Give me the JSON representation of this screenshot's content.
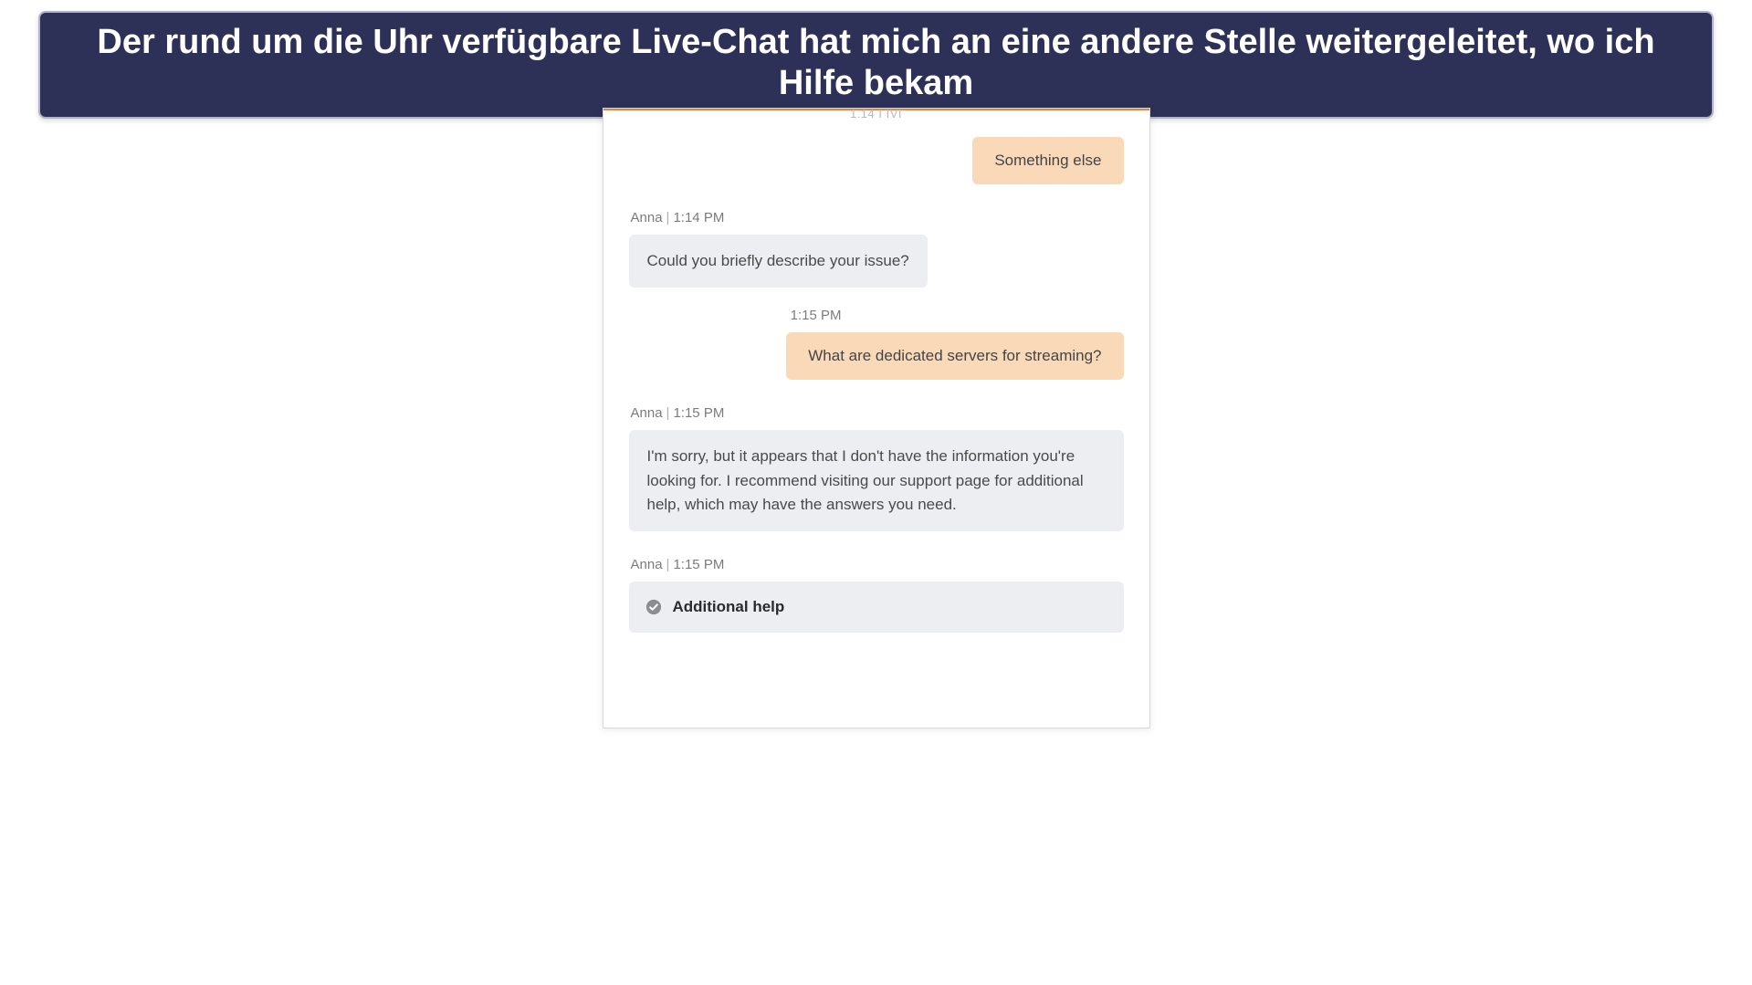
{
  "banner": {
    "text": "Der rund um die Uhr verfügbare Live-Chat hat mich an eine andere Stelle weitergeleitet, wo ich Hilfe bekam"
  },
  "chat": {
    "top_time_fragment": "1.14 I IVI",
    "messages": [
      {
        "side": "user",
        "text": "Something else"
      },
      {
        "side": "agent",
        "sender": "Anna",
        "time": "1:14 PM",
        "text": "Could you briefly describe your issue?"
      },
      {
        "side": "user",
        "time": "1:15 PM",
        "text": "What are dedicated servers for streaming?"
      },
      {
        "side": "agent",
        "sender": "Anna",
        "time": "1:15 PM",
        "text": "I'm sorry, but it appears that I don't have the information you're looking for. I recommend visiting our support page for additional help, which may have the answers you need."
      },
      {
        "side": "agent",
        "sender": "Anna",
        "time": "1:15 PM",
        "card": "Additional help"
      }
    ]
  }
}
